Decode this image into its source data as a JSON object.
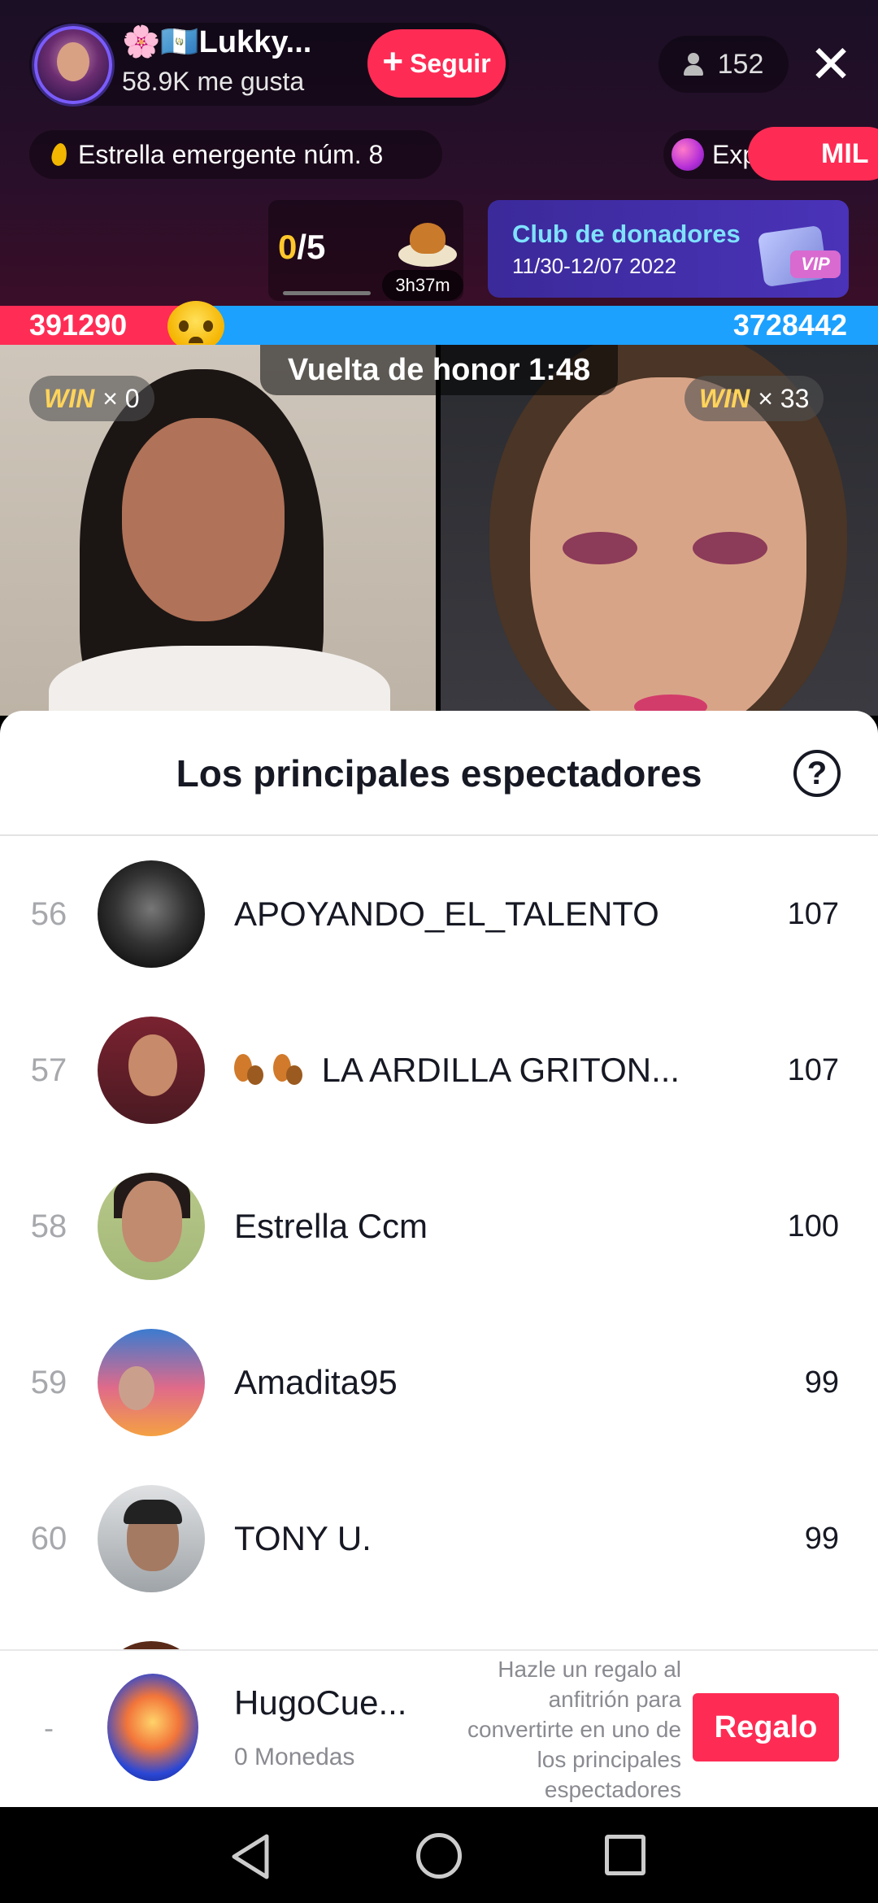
{
  "live": {
    "host_name": "🌸🇬🇹Lukky...",
    "host_likes": "58.9K me gusta",
    "follow_label": "Seguir",
    "viewer_count": "152",
    "rank_badge": "Estrella emergente núm. 8",
    "explore_label": "Explorar",
    "promo_label": "MIL",
    "goal_current": "0",
    "goal_total": "/5",
    "goal_timer": "3h37m",
    "club_title": "Club de donadores",
    "club_dates": "11/30-12/07 2022",
    "club_vip": "VIP"
  },
  "battle": {
    "left_score": "391290",
    "right_score": "3728442",
    "left_share": 0.095,
    "banner": "Vuelta de honor 1:48",
    "left_win_label": "WIN",
    "left_win_count": "× 0",
    "right_win_label": "WIN",
    "right_win_count": "× 33"
  },
  "sheet": {
    "title": "Los principales espectadores",
    "rows": [
      {
        "rank": "56",
        "name": "APOYANDO_EL_TALENTO",
        "score": "107"
      },
      {
        "rank": "57",
        "name": "LA ARDILLA GRITON...",
        "score": "107"
      },
      {
        "rank": "58",
        "name": "Estrella Ccm",
        "score": "100"
      },
      {
        "rank": "59",
        "name": "Amadita95",
        "score": "99"
      },
      {
        "rank": "60",
        "name": "TONY U.",
        "score": "99"
      }
    ]
  },
  "me": {
    "rank": "-",
    "name": "HugoCue...",
    "coins": "0 Monedas",
    "hint": "Hazle un regalo al anfitrión para convertirte en uno de los principales espectadores",
    "gift_label": "Regalo"
  }
}
